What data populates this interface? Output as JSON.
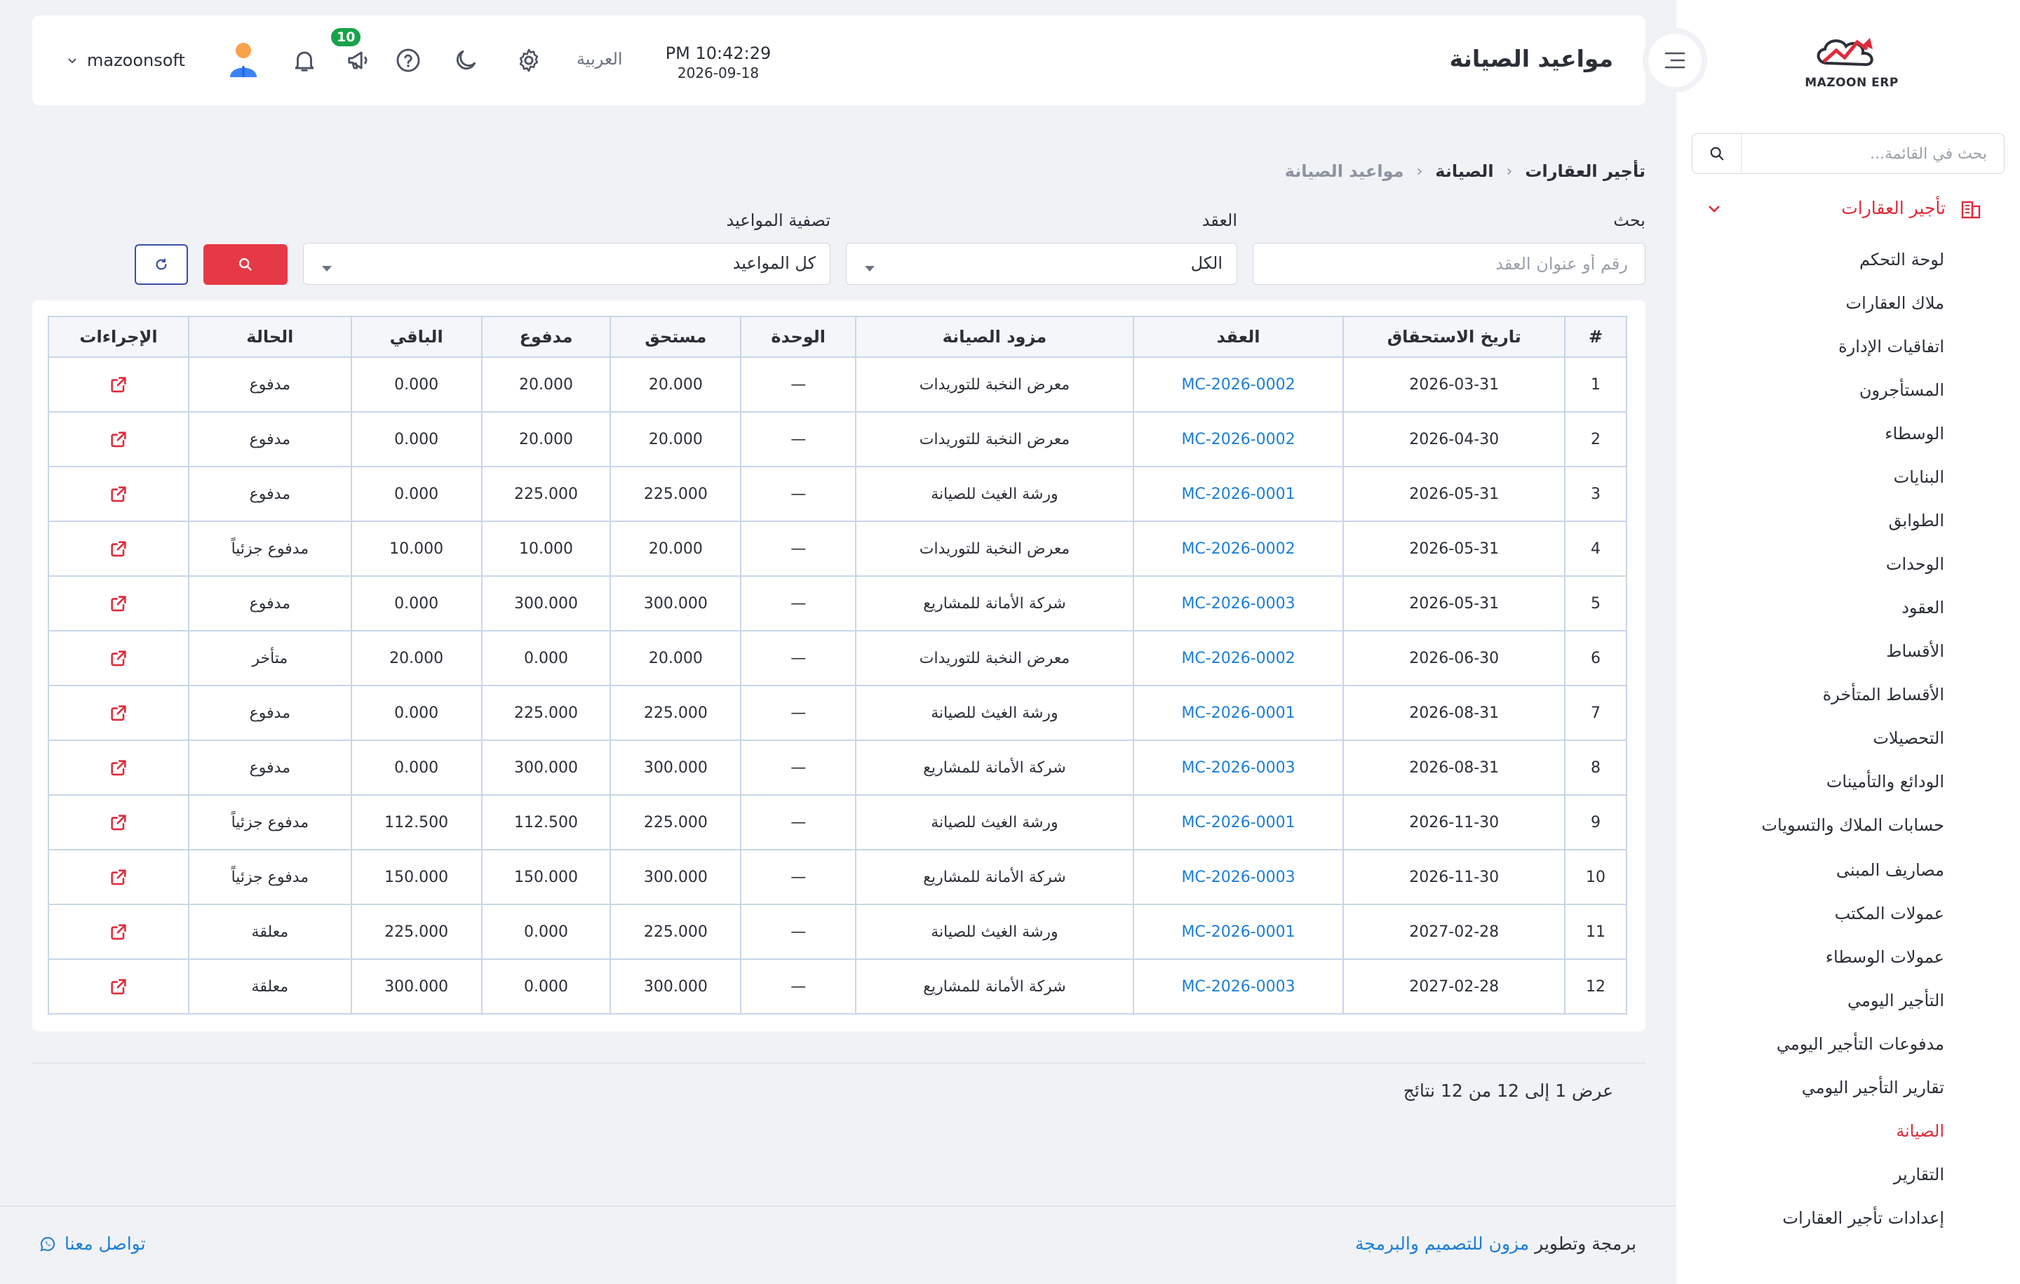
{
  "sidebar": {
    "logo_text": "MAZOON ERP",
    "search_placeholder": "بحث في القائمة...",
    "group_label": "تأجير العقارات",
    "items": [
      {
        "label": "لوحة التحكم"
      },
      {
        "label": "ملاك العقارات"
      },
      {
        "label": "اتفاقيات الإدارة"
      },
      {
        "label": "المستأجرون"
      },
      {
        "label": "الوسطاء"
      },
      {
        "label": "البنايات"
      },
      {
        "label": "الطوابق"
      },
      {
        "label": "الوحدات"
      },
      {
        "label": "العقود"
      },
      {
        "label": "الأقساط"
      },
      {
        "label": "الأقساط المتأخرة"
      },
      {
        "label": "التحصيلات"
      },
      {
        "label": "الودائع والتأمينات"
      },
      {
        "label": "حسابات الملاك والتسويات"
      },
      {
        "label": "مصاريف المبنى"
      },
      {
        "label": "عمولات المكتب"
      },
      {
        "label": "عمولات الوسطاء"
      },
      {
        "label": "التأجير اليومي"
      },
      {
        "label": "مدفوعات التأجير اليومي"
      },
      {
        "label": "تقارير التأجير اليومي"
      },
      {
        "label": "الصيانة"
      },
      {
        "label": "التقارير"
      },
      {
        "label": "إعدادات تأجير العقارات"
      }
    ],
    "active_item": "الصيانة"
  },
  "header": {
    "title": "مواعيد الصيانة",
    "time": "PM 10:42:29",
    "date": "2026-09-18",
    "language": "العربية",
    "notification_count": "10",
    "username": "mazoonsoft"
  },
  "breadcrumb": [
    "تأجير العقارات",
    "الصيانة",
    "مواعيد الصيانة"
  ],
  "filters": {
    "search_label": "بحث",
    "search_placeholder": "رقم أو عنوان العقد",
    "contract_label": "العقد",
    "contract_value": "الكل",
    "schedule_label": "تصفية المواعيد",
    "schedule_value": "كل المواعيد"
  },
  "table": {
    "headers": [
      "#",
      "تاريخ الاستحقاق",
      "العقد",
      "مزود الصيانة",
      "الوحدة",
      "مستحق",
      "مدفوع",
      "الباقي",
      "الحالة",
      "الإجراءات"
    ],
    "rows": [
      [
        "1",
        "2026-03-31",
        "MC-2026-0002",
        "معرض النخبة للتوريدات",
        "—",
        "20.000",
        "20.000",
        "0.000",
        "مدفوع"
      ],
      [
        "2",
        "2026-04-30",
        "MC-2026-0002",
        "معرض النخبة للتوريدات",
        "—",
        "20.000",
        "20.000",
        "0.000",
        "مدفوع"
      ],
      [
        "3",
        "2026-05-31",
        "MC-2026-0001",
        "ورشة الغيث للصيانة",
        "—",
        "225.000",
        "225.000",
        "0.000",
        "مدفوع"
      ],
      [
        "4",
        "2026-05-31",
        "MC-2026-0002",
        "معرض النخبة للتوريدات",
        "—",
        "20.000",
        "10.000",
        "10.000",
        "مدفوع جزئياً"
      ],
      [
        "5",
        "2026-05-31",
        "MC-2026-0003",
        "شركة الأمانة للمشاريع",
        "—",
        "300.000",
        "300.000",
        "0.000",
        "مدفوع"
      ],
      [
        "6",
        "2026-06-30",
        "MC-2026-0002",
        "معرض النخبة للتوريدات",
        "—",
        "20.000",
        "0.000",
        "20.000",
        "متأخر"
      ],
      [
        "7",
        "2026-08-31",
        "MC-2026-0001",
        "ورشة الغيث للصيانة",
        "—",
        "225.000",
        "225.000",
        "0.000",
        "مدفوع"
      ],
      [
        "8",
        "2026-08-31",
        "MC-2026-0003",
        "شركة الأمانة للمشاريع",
        "—",
        "300.000",
        "300.000",
        "0.000",
        "مدفوع"
      ],
      [
        "9",
        "2026-11-30",
        "MC-2026-0001",
        "ورشة الغيث للصيانة",
        "—",
        "225.000",
        "112.500",
        "112.500",
        "مدفوع جزئياً"
      ],
      [
        "10",
        "2026-11-30",
        "MC-2026-0003",
        "شركة الأمانة للمشاريع",
        "—",
        "300.000",
        "150.000",
        "150.000",
        "مدفوع جزئياً"
      ],
      [
        "11",
        "2027-02-28",
        "MC-2026-0001",
        "ورشة الغيث للصيانة",
        "—",
        "225.000",
        "0.000",
        "225.000",
        "معلقة"
      ],
      [
        "12",
        "2027-02-28",
        "MC-2026-0003",
        "شركة الأمانة للمشاريع",
        "—",
        "300.000",
        "0.000",
        "300.000",
        "معلقة"
      ]
    ]
  },
  "results_text": "عرض 1 إلى 12 من 12 نتائج",
  "footer": {
    "credit_prefix": "برمجة وتطوير",
    "credit_link": "مزون للتصميم والبرمجة",
    "contact": "تواصل معنا"
  },
  "colors": {
    "accent_red": "#e02b3a",
    "link_blue": "#1c7ed6",
    "badge_green": "#16a34a"
  }
}
